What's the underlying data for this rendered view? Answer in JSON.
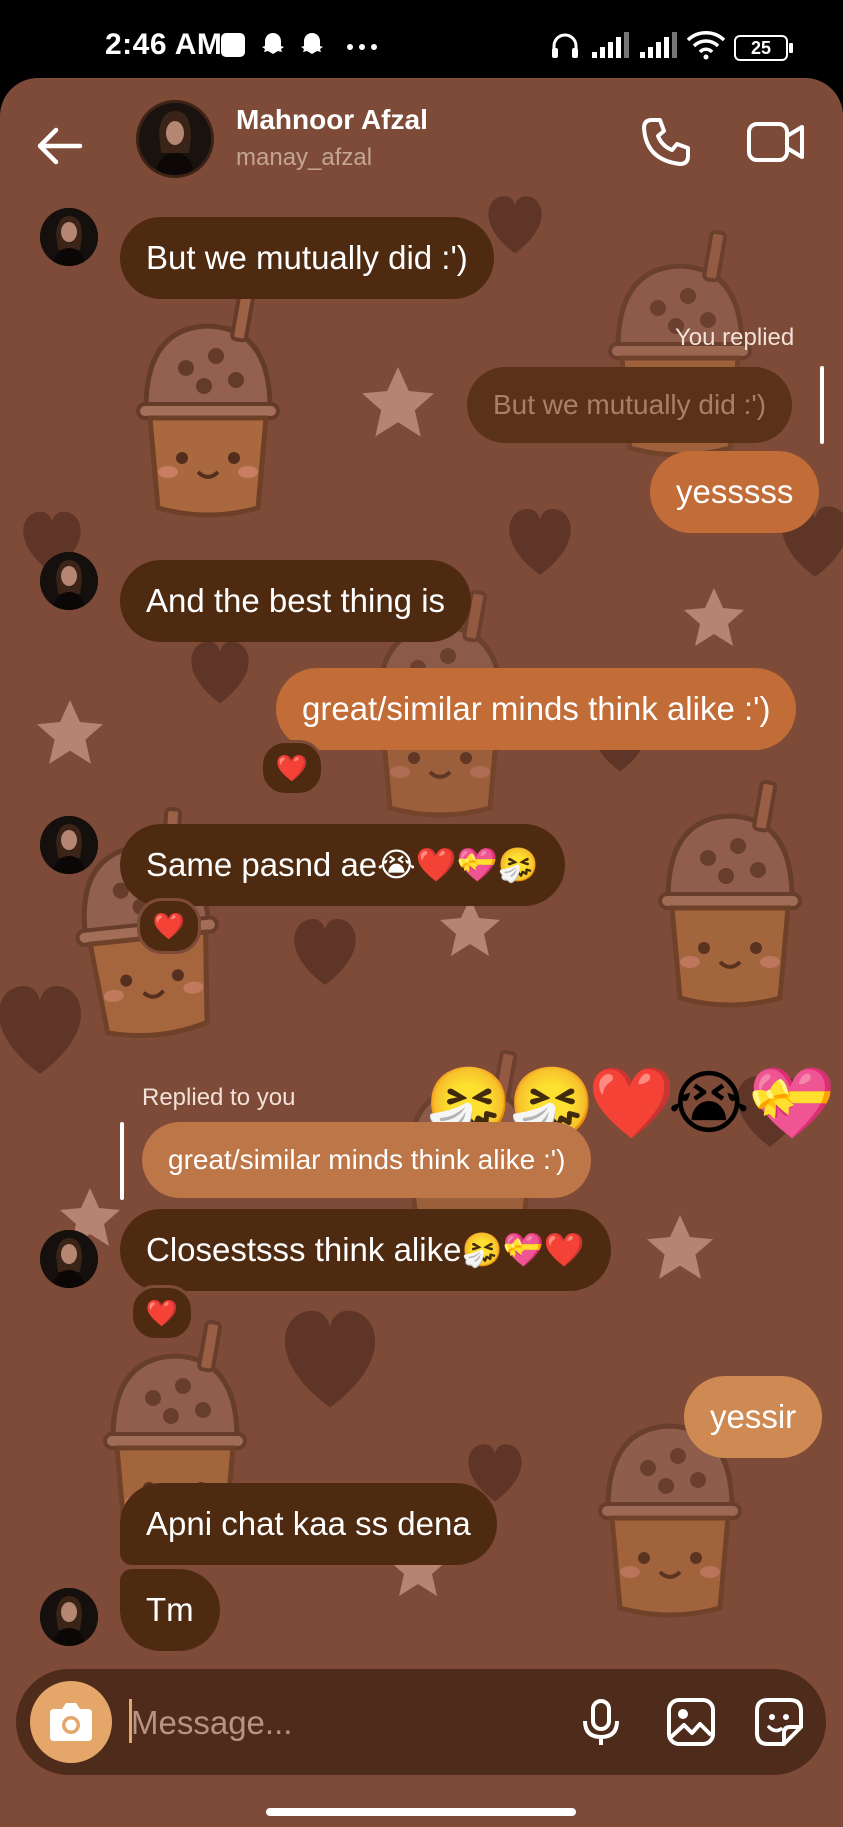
{
  "status_bar": {
    "time": "2:46 AM",
    "battery": "25",
    "icons": [
      "square-notification-icon",
      "snapchat-icon",
      "snapchat-icon",
      "more-dots-icon",
      "headphones-icon",
      "signal-icon",
      "signal-icon",
      "wifi-icon",
      "battery-icon"
    ]
  },
  "header": {
    "name": "Mahnoor Afzal",
    "username": "manay_afzal",
    "icons": [
      "back-arrow-icon",
      "phone-icon",
      "video-icon"
    ]
  },
  "messages": {
    "m1": "But we mutually did :')",
    "you_replied_label": "You replied",
    "m2_quote": "But we mutually did :')",
    "m2": "yesssss",
    "m3": "And the best thing is",
    "m4": "great/similar minds think alike :')",
    "m4_reaction": "❤️",
    "m5": "Same pasnd ae😭❤️💝🤧",
    "m5_reaction": "❤️",
    "emoji_row": [
      "🤧",
      "🤧",
      "❤️",
      "😭",
      "💝"
    ],
    "replied_to_you_label": "Replied to you",
    "m6_quote": "great/similar minds think alike :')",
    "m6": "Closestsss think alike🤧💝❤️",
    "m6_reaction": "❤️",
    "m7": "yessir",
    "m8": "Apni chat kaa ss dena",
    "m9": "Tm"
  },
  "composer": {
    "placeholder": "Message...",
    "icons": [
      "camera-icon",
      "microphone-icon",
      "gallery-icon",
      "sticker-icon"
    ]
  },
  "colors": {
    "background": "#7d4b38",
    "incoming_bubble": "#4e2b10",
    "outgoing_bubble": "#c26c38",
    "accent": "#e5a66a"
  }
}
